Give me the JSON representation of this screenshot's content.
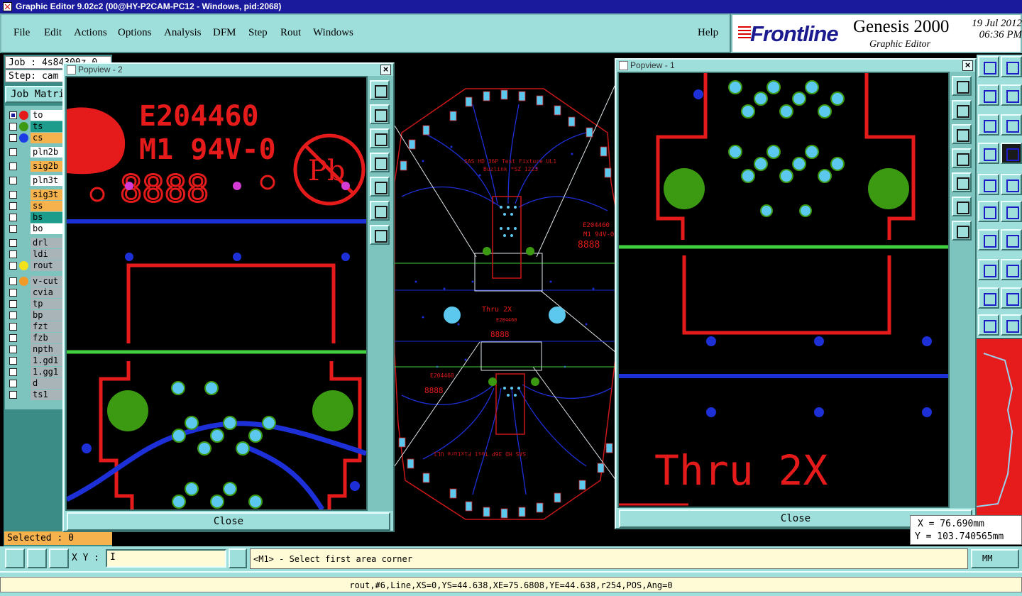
{
  "window": {
    "title": "Graphic Editor 9.02c2 (00@HY-P2CAM-PC12 - Windows, pid:2068)"
  },
  "menu": {
    "items": [
      "File",
      "Edit",
      "Actions",
      "Options",
      "Analysis",
      "DFM",
      "Step",
      "Rout",
      "Windows"
    ],
    "help": "Help"
  },
  "brand": {
    "logo": "Frontline",
    "product": "Genesis 2000",
    "subtitle": "Graphic Editor",
    "date": "19 Jul 2012",
    "time": "06:36 PM"
  },
  "job": {
    "job_label": "Job : 4s84300z-0",
    "step_label": "Step: cam",
    "matrix_button": "Job Matrix"
  },
  "layers": [
    {
      "name": "to",
      "dot": "#e51b1b",
      "bg": "#ffffff",
      "checked": true
    },
    {
      "name": "ts",
      "dot": "#3c9a12",
      "bg": "#1d9c8c",
      "checked": false
    },
    {
      "name": "cs",
      "dot": "#1b3de5",
      "bg": "#f6b24d",
      "checked": false
    },
    {
      "name": "pln2b",
      "dot": "",
      "bg": "#ffffff",
      "checked": false
    },
    {
      "name": "sig2b",
      "dot": "",
      "bg": "#f6b24d",
      "checked": false
    },
    {
      "name": "pln3t",
      "dot": "",
      "bg": "#ffffff",
      "checked": false
    },
    {
      "name": "sig3t",
      "dot": "",
      "bg": "#f6b24d",
      "checked": false
    },
    {
      "name": "ss",
      "dot": "",
      "bg": "#f6b24d",
      "checked": false
    },
    {
      "name": "bs",
      "dot": "",
      "bg": "#1d9c8c",
      "checked": false
    },
    {
      "name": "bo",
      "dot": "",
      "bg": "#ffffff",
      "checked": false
    },
    {
      "name": "drl",
      "dot": "",
      "bg": "#a8b4b8",
      "checked": false
    },
    {
      "name": "ldi",
      "dot": "",
      "bg": "#a8b4b8",
      "checked": false
    },
    {
      "name": "rout",
      "dot": "#f2e21a",
      "bg": "#a8b4b8",
      "checked": false
    },
    {
      "name": "v-cut",
      "dot": "#f09a2a",
      "bg": "#a8b4b8",
      "checked": false
    },
    {
      "name": "cvia",
      "dot": "",
      "bg": "#a8b4b8",
      "checked": false
    },
    {
      "name": "tp",
      "dot": "",
      "bg": "#a8b4b8",
      "checked": false
    },
    {
      "name": "bp",
      "dot": "",
      "bg": "#a8b4b8",
      "checked": false
    },
    {
      "name": "fzt",
      "dot": "",
      "bg": "#a8b4b8",
      "checked": false
    },
    {
      "name": "fzb",
      "dot": "",
      "bg": "#a8b4b8",
      "checked": false
    },
    {
      "name": "npth",
      "dot": "",
      "bg": "#a8b4b8",
      "checked": false
    },
    {
      "name": "1.gd1",
      "dot": "",
      "bg": "#a8b4b8",
      "checked": false
    },
    {
      "name": "1.gg1",
      "dot": "",
      "bg": "#a8b4b8",
      "checked": false
    },
    {
      "name": "d",
      "dot": "",
      "bg": "#a8b4b8",
      "checked": false
    },
    {
      "name": "ts1",
      "dot": "",
      "bg": "#a8b4b8",
      "checked": false
    }
  ],
  "selected": "Selected : 0",
  "popview2": {
    "title": "Popview - 2",
    "close": "Close",
    "cert_line1": "E204460",
    "cert_line2": "M1 94V-0",
    "digits": "8888",
    "pb": "Pb"
  },
  "popview1": {
    "title": "Popview - 1",
    "close": "Close",
    "label": "Thru 2X"
  },
  "board": {
    "text1": "SAS HD 36P Test Fixture UL1",
    "text2": "Buzlink *SZ 1223",
    "cert": "E204460",
    "cert2": "M1 94V-0",
    "digits": "8888",
    "thru": "Thru 2X"
  },
  "coords": {
    "x": "X = 76.690mm",
    "y": "Y = 103.740565mm"
  },
  "xy": {
    "label": "X Y :",
    "value": "I"
  },
  "prompt": "<M1> - Select first area corner",
  "units": "MM",
  "status": "rout,#6,Line,XS=0,YS=44.638,XE=75.6808,YE=44.638,r254,POS,Ang=0"
}
